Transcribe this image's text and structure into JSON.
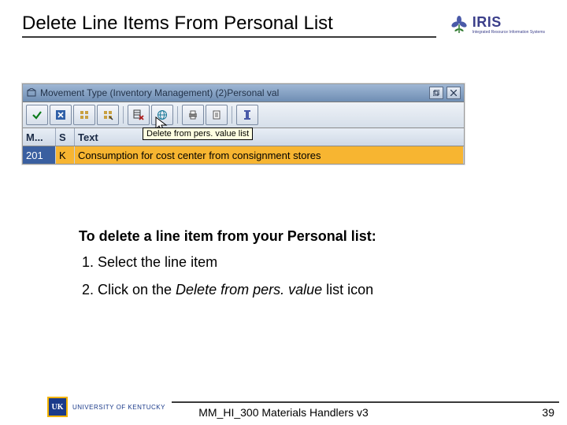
{
  "header": {
    "title": "Delete Line Items From Personal List",
    "logo_text": "IRIS",
    "logo_sub": "Integrated Resource Information Systems"
  },
  "sap": {
    "titlebar": "Movement Type (Inventory Management) (2)Personal val",
    "tooltip": "Delete from pers. value list",
    "columns": {
      "m": "M...",
      "s": "S",
      "t": "Text"
    },
    "row": {
      "m": "201",
      "s": "K",
      "t": "Consumption for cost center from consignment stores"
    }
  },
  "instructions": {
    "head": "To delete a line item from your Personal list:",
    "step1": "Select the line item",
    "step2_pre": "Click on the ",
    "step2_italic": "Delete from pers. value",
    "step2_post": " list icon"
  },
  "footer": {
    "badge_mark": "UK",
    "badge_text": "UNIVERSITY OF KENTUCKY",
    "doc": "MM_HI_300 Materials Handlers v3",
    "page": "39"
  }
}
